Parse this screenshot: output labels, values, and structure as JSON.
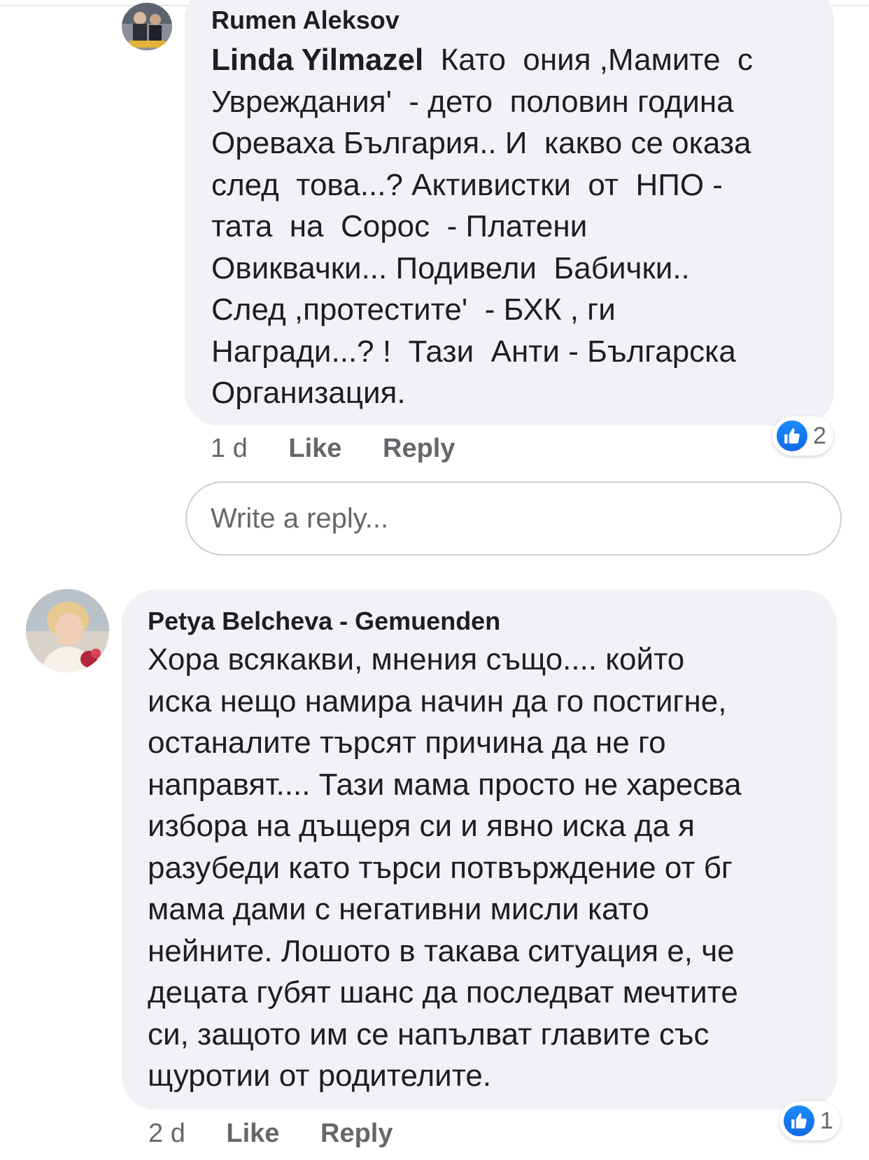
{
  "comment1": {
    "author": "Rumen Aleksov",
    "mention": "Linda Yilmazel",
    "lines": [
      "  Като  ония ,Мамите  с",
      "Увреждания'  - дето  половин година",
      "Ореваха България.. И  какво се оказа",
      "след  това...? Активистки  от  НПО -",
      "тата  на  Сорос  - Платени",
      "Овиквачки... Подивели  Бабички..",
      "След ,протестите'  - БХК , ги",
      "Награди...? !  Тази  Анти - Българска",
      "Организация."
    ],
    "time": "1 d",
    "like_label": "Like",
    "reply_label": "Reply",
    "reaction_count": "2"
  },
  "reply_box": {
    "placeholder": "Write a reply..."
  },
  "comment2": {
    "author": "Petya Belcheva - Gemuenden",
    "lines": [
      "Хора всякакви, мнения също.... който",
      "иска нещо намира начин да го постигне,",
      "останалите търсят причина да не го",
      "направят.... Тази мама просто не харесва",
      "избора на дъщеря си и явно иска да я",
      "разубеди като търси потвърждение от бг",
      "мама дами с негативни мисли като",
      "нейните. Лошото в такава ситуация е, че",
      "децата губят шанс да последват мечтите",
      "си, защото им се напълват главите със",
      "щуротии от родителите."
    ],
    "time": "2 d",
    "like_label": "Like",
    "reply_label": "Reply",
    "reaction_count": "1"
  },
  "colors": {
    "bubble": "#f0f2f5",
    "text": "#1c1e21",
    "secondary": "#65676b",
    "like_blue": "#1877f2"
  },
  "icons": {
    "reaction": "thumbs-up-icon"
  }
}
